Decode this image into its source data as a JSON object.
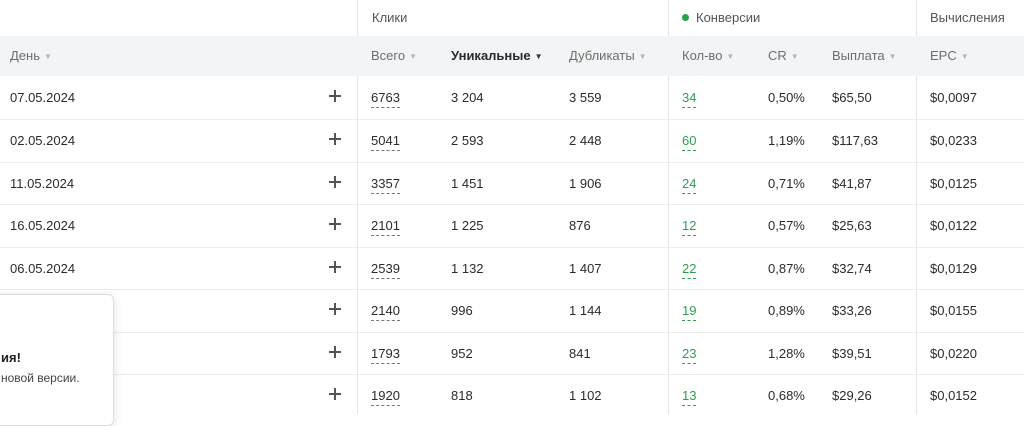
{
  "groups": {
    "clicks": "Клики",
    "conversions": "Конверсии",
    "calc": "Вычисления"
  },
  "columns": {
    "day": "День",
    "total": "Всего",
    "unique": "Уникальные",
    "duplicates": "Дубликаты",
    "count": "Кол-во",
    "cr": "CR",
    "payout": "Выплата",
    "epc": "EPC"
  },
  "rows": [
    {
      "day": "07.05.2024",
      "total": "6763",
      "unique": "3 204",
      "duplicates": "3 559",
      "count": "34",
      "cr": "0,50%",
      "payout": "$65,50",
      "epc": "$0,0097"
    },
    {
      "day": "02.05.2024",
      "total": "5041",
      "unique": "2 593",
      "duplicates": "2 448",
      "count": "60",
      "cr": "1,19%",
      "payout": "$117,63",
      "epc": "$0,0233"
    },
    {
      "day": "11.05.2024",
      "total": "3357",
      "unique": "1 451",
      "duplicates": "1 906",
      "count": "24",
      "cr": "0,71%",
      "payout": "$41,87",
      "epc": "$0,0125"
    },
    {
      "day": "16.05.2024",
      "total": "2101",
      "unique": "1 225",
      "duplicates": "876",
      "count": "12",
      "cr": "0,57%",
      "payout": "$25,63",
      "epc": "$0,0122"
    },
    {
      "day": "06.05.2024",
      "total": "2539",
      "unique": "1 132",
      "duplicates": "1 407",
      "count": "22",
      "cr": "0,87%",
      "payout": "$32,74",
      "epc": "$0,0129"
    },
    {
      "day": "",
      "total": "2140",
      "unique": "996",
      "duplicates": "1 144",
      "count": "19",
      "cr": "0,89%",
      "payout": "$33,26",
      "epc": "$0,0155"
    },
    {
      "day": "",
      "total": "1793",
      "unique": "952",
      "duplicates": "841",
      "count": "23",
      "cr": "1,28%",
      "payout": "$39,51",
      "epc": "$0,0220"
    },
    {
      "day": "",
      "total": "1920",
      "unique": "818",
      "duplicates": "1 102",
      "count": "13",
      "cr": "0,68%",
      "payout": "$29,26",
      "epc": "$0,0152"
    }
  ],
  "popup": {
    "title": "ия!",
    "text": "новой версии."
  },
  "colors": {
    "accent_green": "#2e9e4f",
    "header_bg": "#f3f4f5"
  }
}
